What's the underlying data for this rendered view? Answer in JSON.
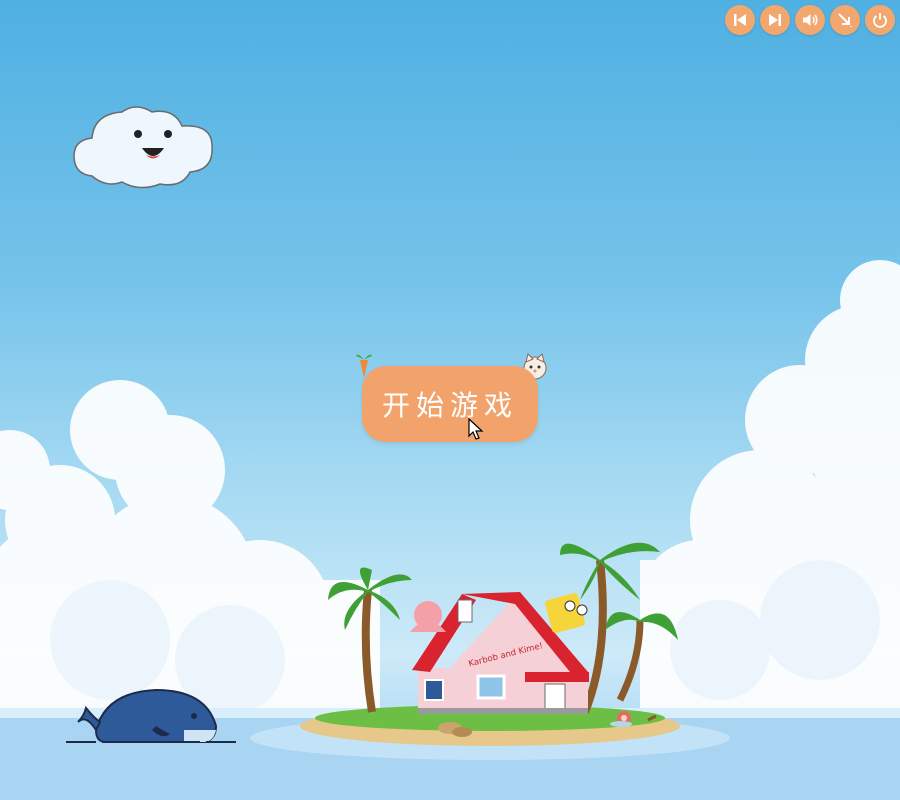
{
  "toolbar": {
    "buttons": [
      {
        "name": "previous",
        "icon": "skip-back-icon"
      },
      {
        "name": "next",
        "icon": "skip-forward-icon"
      },
      {
        "name": "volume",
        "icon": "speaker-icon"
      },
      {
        "name": "minimize",
        "icon": "arrow-collapse-icon"
      },
      {
        "name": "power",
        "icon": "power-icon"
      }
    ],
    "color": "#f2a76e"
  },
  "start_button": {
    "label": "开始游戏",
    "color": "#f2a36b"
  },
  "island": {
    "house_sign": "Karbob and Kime!"
  },
  "colors": {
    "sky_top": "#4fb0e2",
    "sea": "#9ccdf0",
    "roof": "#d9232e",
    "whale": "#2f5a9a"
  }
}
